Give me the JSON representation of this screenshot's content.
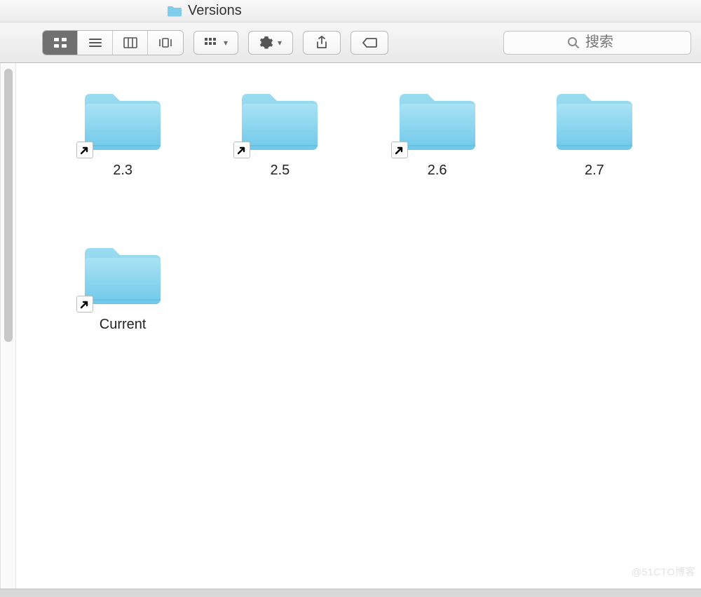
{
  "window": {
    "title": "Versions"
  },
  "toolbar": {
    "view_modes": [
      "icon",
      "list",
      "column",
      "coverflow"
    ],
    "active_view": "icon",
    "arrange_label": "group",
    "action_label": "gear",
    "share_label": "share",
    "tags_label": "tags"
  },
  "search": {
    "placeholder": "搜索",
    "value": ""
  },
  "items": [
    {
      "name": "2.3",
      "type": "folder",
      "alias": true
    },
    {
      "name": "2.5",
      "type": "folder",
      "alias": true
    },
    {
      "name": "2.6",
      "type": "folder",
      "alias": true
    },
    {
      "name": "2.7",
      "type": "folder",
      "alias": false
    },
    {
      "name": "Current",
      "type": "folder",
      "alias": true
    }
  ],
  "watermark": "@51CTO博客"
}
